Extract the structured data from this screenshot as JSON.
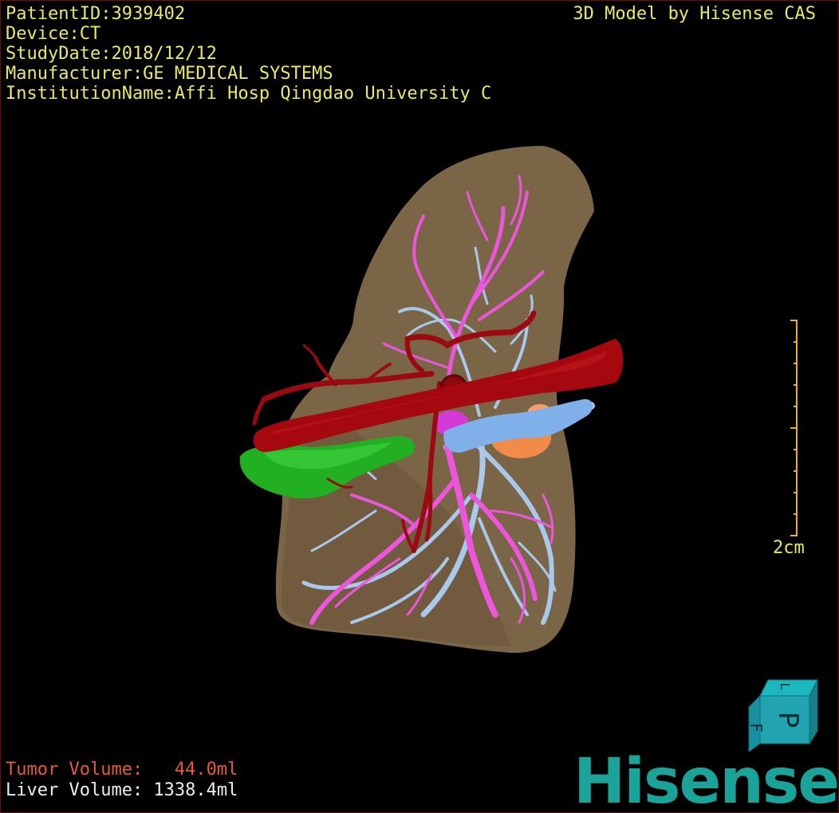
{
  "patient": {
    "id_line": "PatientID:3939402",
    "device_line": "Device:CT",
    "study_date_line": "StudyDate:2018/12/12",
    "manufacturer_line": "Manufacturer:GE MEDICAL SYSTEMS",
    "institution_line": "InstitutionName:Affi Hosp Qingdao University C"
  },
  "credit": "3D Model by Hisense CAS",
  "scale": {
    "label": "2cm"
  },
  "volumes": {
    "tumor_line": "Tumor Volume:   44.0ml",
    "liver_line": "Liver Volume: 1338.4ml"
  },
  "orientation_cube": {
    "faces": [
      "L",
      "P",
      "F"
    ]
  },
  "logo": "Hisense",
  "colors": {
    "overlay_text": "#e8e86a",
    "tumor_text": "#e65a3a",
    "liver": "#7b6547",
    "portal_vein": "#ee55dd",
    "hepatic_vein": "#a8c8ec",
    "artery": "#9a0a10",
    "gallbladder": "#22b022",
    "tumor": "#f28a4a",
    "brand": "#1aa398"
  },
  "structures": [
    "liver",
    "hepatic-vein-tree",
    "portal-vein-tree",
    "tumor",
    "gallbladder",
    "artery-tree",
    "inferior-vena-cava"
  ]
}
